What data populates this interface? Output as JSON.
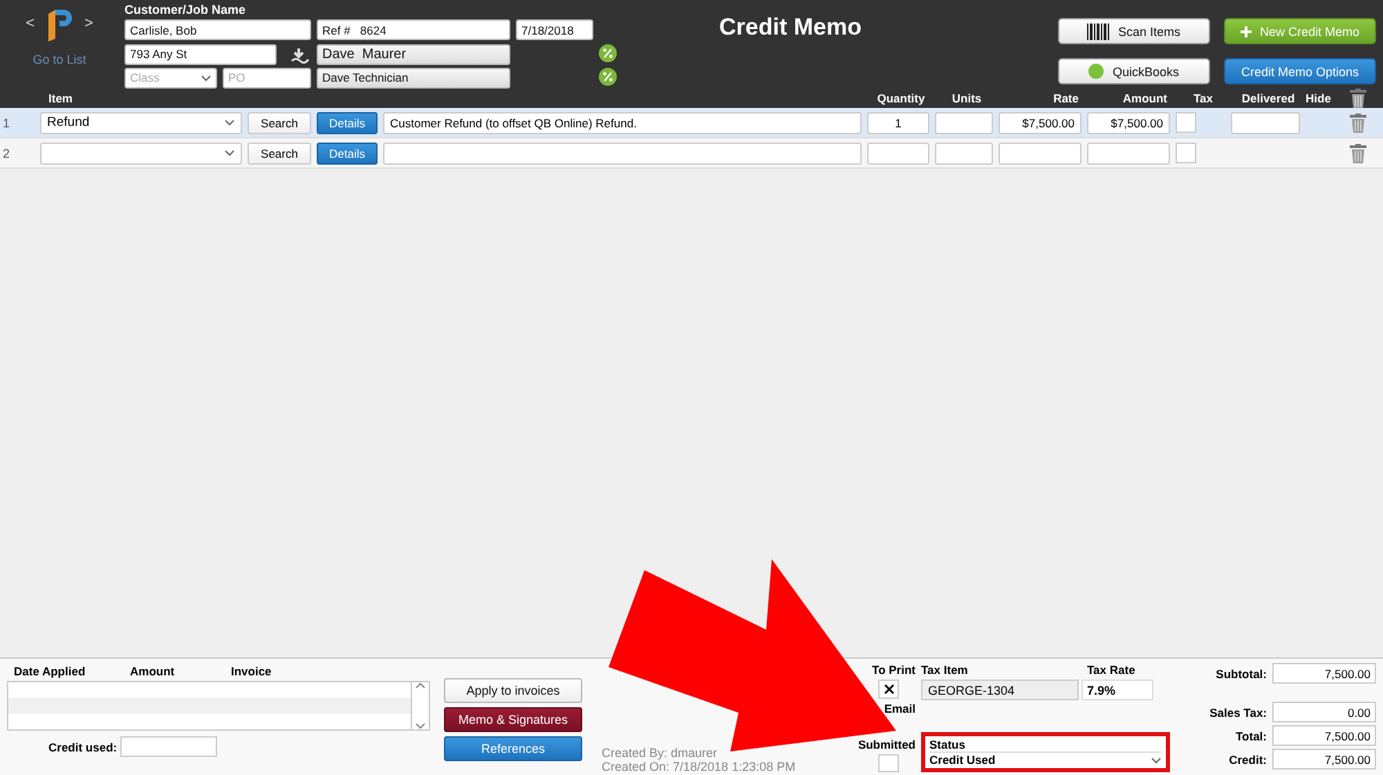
{
  "header": {
    "nav": {
      "prev": "<",
      "next": ">",
      "link": "Go to List"
    },
    "customer_label": "Customer/Job Name",
    "customer": "Carlisle, Bob",
    "ref": "Ref #   8624",
    "date": "7/18/2018",
    "address": "793 Any St",
    "rep": "Dave  Maurer",
    "class_placeholder": "Class",
    "po_placeholder": "PO",
    "technician": "Dave Technician",
    "title": "Credit Memo",
    "buttons": [
      {
        "label": "Scan Items",
        "kind": "scan"
      },
      {
        "label": "New Credit Memo",
        "kind": "new"
      },
      {
        "label": "QuickBooks",
        "kind": "quickbooks"
      },
      {
        "label": "Credit Memo Options",
        "kind": "options"
      }
    ]
  },
  "columns": [
    "Item",
    "Quantity",
    "Units",
    "Rate",
    "Amount",
    "Tax",
    "Delivered",
    "Hide"
  ],
  "rows": [
    {
      "number": "1",
      "item": "Refund",
      "search": "Search",
      "details": "Details",
      "description": "Customer Refund (to offset QB Online) Refund.",
      "quantity": "1",
      "rate": "$7,500.00",
      "amount": "$7,500.00",
      "selected": true
    },
    {
      "number": "2",
      "search": "Search",
      "details": "Details",
      "selected": false
    }
  ],
  "applied": {
    "columns": [
      "Date Applied",
      "Amount",
      "Invoice"
    ],
    "credit_used_label": "Credit used:"
  },
  "actions": [
    {
      "label": "Apply to invoices",
      "kind": "plain"
    },
    {
      "label": "Memo & Signatures",
      "kind": "memo"
    },
    {
      "label": "References",
      "kind": "blue"
    }
  ],
  "created": [
    "Created By: dmaurer",
    "Created On: 7/18/2018 1:23:08 PM"
  ],
  "delivery": {
    "to_print_label": "To Print",
    "to_print": true,
    "email_label": "Email",
    "submitted_label": "Submitted",
    "submitted": false
  },
  "tax": {
    "item_label": "Tax Item",
    "item": "GEORGE-1304",
    "rate_label": "Tax Rate",
    "rate": "7.9%"
  },
  "status": {
    "label": "Status",
    "value": "Credit Used"
  },
  "totals": [
    {
      "label": "Subtotal:",
      "value": "7,500.00"
    },
    {
      "label": "Sales Tax:",
      "value": "0.00"
    },
    {
      "label": "Total:",
      "value": "7,500.00"
    },
    {
      "label": "Credit:",
      "value": "7,500.00"
    }
  ]
}
